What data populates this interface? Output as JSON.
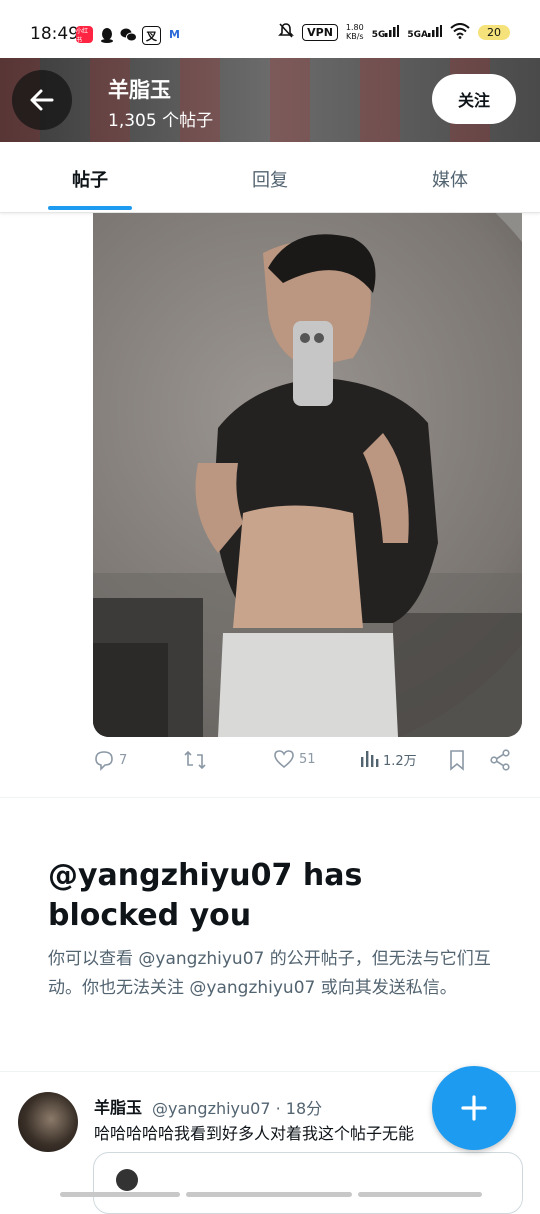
{
  "status_bar": {
    "time": "18:49",
    "speed_value": "1.80",
    "speed_unit": "KB/s",
    "vpn": "VPN",
    "net1": "5G",
    "net2": "5GA",
    "battery": "20",
    "app_badge_1": "小红书",
    "app_badge_4": "叉",
    "app_badge_5": "M"
  },
  "header": {
    "name": "羊脂玉",
    "post_count": "1,305 个帖子",
    "follow_label": "关注"
  },
  "tabs": [
    {
      "label": "帖子",
      "active": true
    },
    {
      "label": "回复",
      "active": false
    },
    {
      "label": "媒体",
      "active": false
    }
  ],
  "post_actions": {
    "replies": "7",
    "retweets": "",
    "likes": "51",
    "views": "1.2万"
  },
  "blocked": {
    "title": "@yangzhiyu07 has blocked you",
    "description": "你可以查看 @yangzhiyu07 的公开帖子，但无法与它们互动。你也无法关注 @yangzhiyu07 或向其发送私信。"
  },
  "tweet": {
    "name": "羊脂玉",
    "handle_time": "@yangzhiyu07 · 18分",
    "text": "哈哈哈哈哈我看到好多人对着我这个帖子无能"
  },
  "colors": {
    "accent": "#1d9bf0",
    "text_primary": "#0f1419",
    "text_secondary": "#536471"
  }
}
